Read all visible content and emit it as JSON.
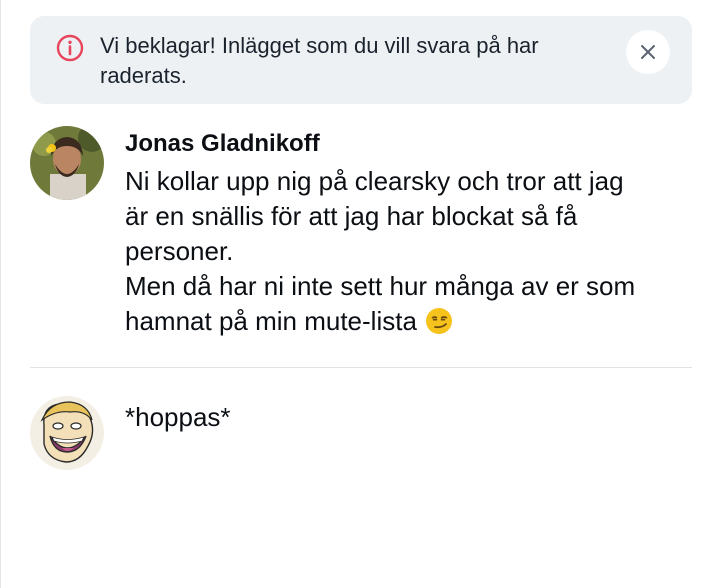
{
  "banner": {
    "message": "Vi beklagar! Inlägget som du vill svara på har raderats.",
    "icon": "info-circle-icon",
    "close_icon": "close-icon",
    "accent_color": "#e8455d"
  },
  "posts": [
    {
      "author": "Jonas Gladnikoff",
      "lines": [
        "Ni kollar upp nig på clearsky och tror att jag",
        "är en snällis för att jag har blockat så få",
        "personer.",
        "Men då har ni inte sett hur många av er som",
        "hamnat på min mute-lista"
      ],
      "emoji": "smirking-face-emoji"
    },
    {
      "author": "",
      "lines": [
        "*hoppas*"
      ]
    }
  ]
}
